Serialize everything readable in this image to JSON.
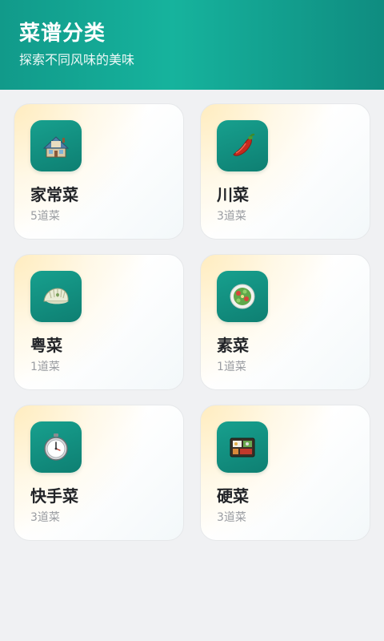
{
  "header": {
    "title": "菜谱分类",
    "subtitle": "探索不同风味的美味"
  },
  "categories": [
    {
      "name": "家常菜",
      "count": "5道菜",
      "icon": "house-icon"
    },
    {
      "name": "川菜",
      "count": "3道菜",
      "icon": "chili-pepper-icon"
    },
    {
      "name": "粤菜",
      "count": "1道菜",
      "icon": "dumpling-icon"
    },
    {
      "name": "素菜",
      "count": "1道菜",
      "icon": "salad-bowl-icon"
    },
    {
      "name": "快手菜",
      "count": "3道菜",
      "icon": "stopwatch-icon"
    },
    {
      "name": "硬菜",
      "count": "3道菜",
      "icon": "bento-box-icon"
    }
  ],
  "colors": {
    "header_gradient_start": "#119a8a",
    "header_gradient_end": "#0f8c80",
    "icon_tile": "#17a08e",
    "background": "#f0f1f3"
  }
}
